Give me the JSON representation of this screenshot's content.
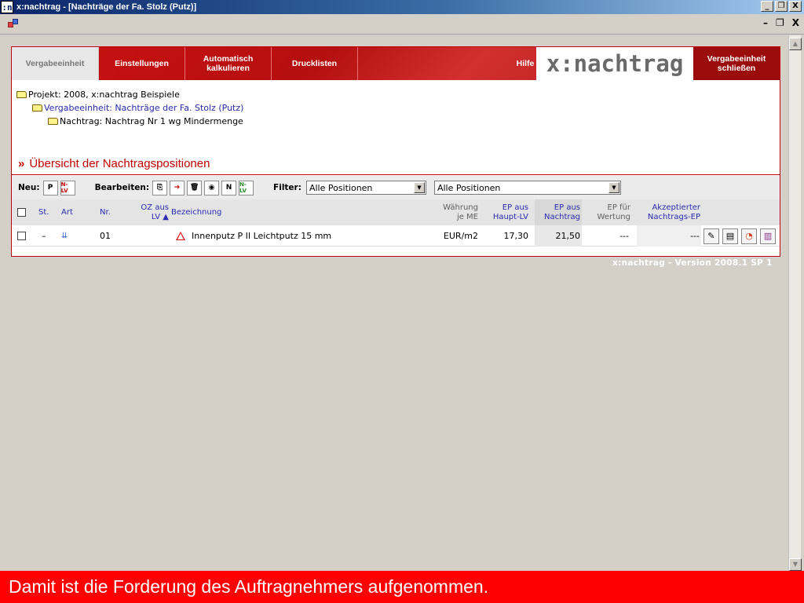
{
  "window": {
    "app_icon": ":n",
    "title": "x:nachtrag - [Nachträge der Fa. Stolz (Putz)]",
    "btn_min": "_",
    "btn_max": "❐",
    "btn_close": "X"
  },
  "mdi": {
    "btn_min": "–",
    "btn_restore": "❐",
    "btn_close": "X"
  },
  "nav": {
    "vergabeeinheit": "Vergabeeinheit",
    "einstellungen": "Einstellungen",
    "auto_line1": "Automatisch",
    "auto_line2": "kalkulieren",
    "drucklisten": "Drucklisten",
    "hilfe": "Hilfe",
    "brand": "x:nachtrag",
    "close_line1": "Vergabeeinheit",
    "close_line2": "schließen"
  },
  "tree": {
    "projekt": "Projekt: 2008, x:nachtrag Beispiele",
    "vergabe": "Vergabeeinheit: Nachträge der Fa. Stolz (Putz)",
    "nachtrag": "Nachtrag: Nachtrag Nr 1 wg Mindermenge"
  },
  "section": {
    "chevron": "»",
    "title": "Übersicht der Nachtragspositionen"
  },
  "toolbar": {
    "neu_label": "Neu:",
    "neu_p": "P",
    "neu_nlv": "N-LV",
    "bearbeiten_label": "Bearbeiten:",
    "edit_n": "N",
    "edit_nlv": "N-LV",
    "filter_label": "Filter:",
    "filter1": "Alle Positionen",
    "filter2": "Alle Positionen"
  },
  "grid": {
    "headers": {
      "st": "St.",
      "art": "Art",
      "nr": "Nr.",
      "oz1": "OZ aus",
      "oz2": "LV ▲",
      "bezeichnung": "Bezeichnung",
      "waehrung1": "Währung",
      "waehrung2": "je ME",
      "ep_haupt1": "EP aus",
      "ep_haupt2": "Haupt-LV",
      "ep_nachtrag1": "EP aus",
      "ep_nachtrag2": "Nachtrag",
      "ep_wertung1": "EP für",
      "ep_wertung2": "Wertung",
      "akzept1": "Akzeptierter",
      "akzept2": "Nachtrags-EP"
    },
    "rows": [
      {
        "st": "–",
        "nr": "01",
        "bezeichnung": "Innenputz P II Leichtputz 15 mm",
        "waehrung": "EUR/m2",
        "ep_haupt": "17,30",
        "ep_nachtrag": "21,50",
        "ep_wertung": "---",
        "akzept": "---"
      }
    ]
  },
  "version": "x:nachtrag - Version 2008.1 SP 1",
  "caption": "Damit ist die Forderung des Auftragnehmers aufgenommen."
}
